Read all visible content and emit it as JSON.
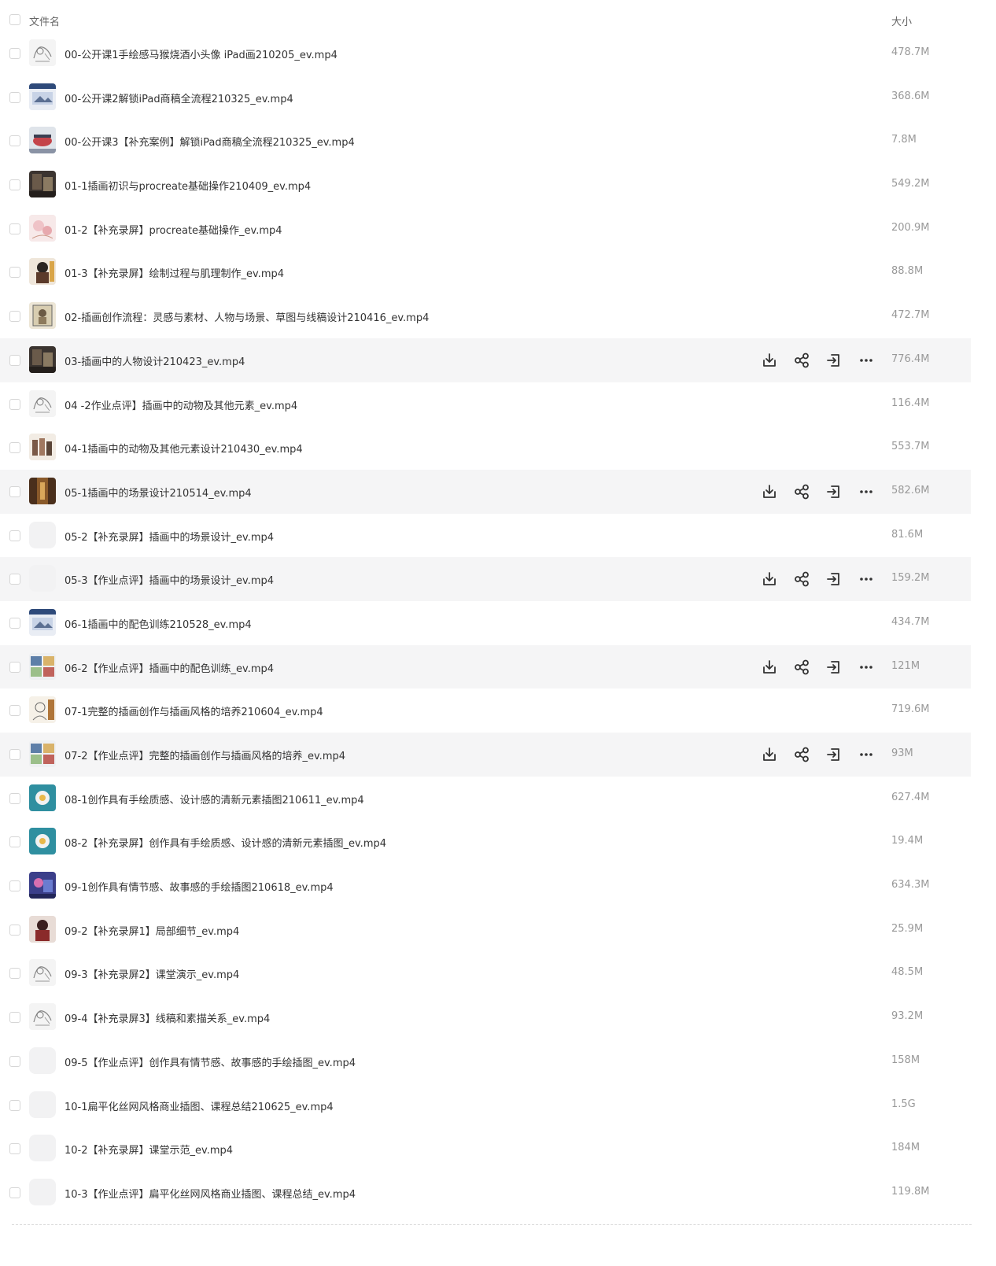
{
  "header": {
    "name_label": "文件名",
    "size_label": "大小"
  },
  "files": [
    {
      "name": "00-公开课1手绘感马猴烧酒小头像 iPad画210205_ev.mp4",
      "size": "478.7M",
      "thumb": "sketch",
      "hover": false
    },
    {
      "name": "00-公开课2解锁iPad商稿全流程210325_ev.mp4",
      "size": "368.6M",
      "thumb": "screen-blue",
      "hover": false
    },
    {
      "name": "00-公开课3【补充案例】解锁iPad商稿全流程210325_ev.mp4",
      "size": "7.8M",
      "thumb": "screen-red",
      "hover": false
    },
    {
      "name": "01-1插画初识与procreate基础操作210409_ev.mp4",
      "size": "549.2M",
      "thumb": "dark-photo",
      "hover": false
    },
    {
      "name": "01-2【补充录屏】procreate基础操作_ev.mp4",
      "size": "200.9M",
      "thumb": "pink",
      "hover": false
    },
    {
      "name": "01-3【补充录屏】绘制过程与肌理制作_ev.mp4",
      "size": "88.8M",
      "thumb": "character",
      "hover": false
    },
    {
      "name": "02-插画创作流程：灵感与素材、人物与场景、草图与线稿设计210416_ev.mp4",
      "size": "472.7M",
      "thumb": "portrait",
      "hover": false
    },
    {
      "name": "03-插画中的人物设计210423_ev.mp4",
      "size": "776.4M",
      "thumb": "dark-photo",
      "hover": true
    },
    {
      "name": "04 -2作业点评】插画中的动物及其他元素_ev.mp4",
      "size": "116.4M",
      "thumb": "sketch",
      "hover": false
    },
    {
      "name": "04-1插画中的动物及其他元素设计210430_ev.mp4",
      "size": "553.7M",
      "thumb": "figures",
      "hover": false
    },
    {
      "name": "05-1插画中的场景设计210514_ev.mp4",
      "size": "582.6M",
      "thumb": "brown",
      "hover": true
    },
    {
      "name": "05-2【补充录屏】插画中的场景设计_ev.mp4",
      "size": "81.6M",
      "thumb": "blank",
      "hover": false
    },
    {
      "name": "05-3【作业点评】插画中的场景设计_ev.mp4",
      "size": "159.2M",
      "thumb": "blank",
      "hover": true
    },
    {
      "name": "06-1插画中的配色训练210528_ev.mp4",
      "size": "434.7M",
      "thumb": "screen-blue",
      "hover": false
    },
    {
      "name": "06-2【作业点评】插画中的配色训练_ev.mp4",
      "size": "121M",
      "thumb": "collage",
      "hover": true
    },
    {
      "name": "07-1完整的插画创作与插画风格的培养210604_ev.mp4",
      "size": "719.6M",
      "thumb": "sketch-color",
      "hover": false
    },
    {
      "name": "07-2【作业点评】完整的插画创作与插画风格的培养_ev.mp4",
      "size": "93M",
      "thumb": "collage",
      "hover": true
    },
    {
      "name": "08-1创作具有手绘质感、设计感的清新元素插图210611_ev.mp4",
      "size": "627.4M",
      "thumb": "teal",
      "hover": false
    },
    {
      "name": "08-2【补充录屏】创作具有手绘质感、设计感的清新元素插图_ev.mp4",
      "size": "19.4M",
      "thumb": "teal",
      "hover": false
    },
    {
      "name": "09-1创作具有情节感、故事感的手绘插图210618_ev.mp4",
      "size": "634.3M",
      "thumb": "purple",
      "hover": false
    },
    {
      "name": "09-2【补充录屏1】局部细节_ev.mp4",
      "size": "25.9M",
      "thumb": "red-dark",
      "hover": false
    },
    {
      "name": "09-3【补充录屏2】课堂演示_ev.mp4",
      "size": "48.5M",
      "thumb": "sketch",
      "hover": false
    },
    {
      "name": "09-4【补充录屏3】线稿和素描关系_ev.mp4",
      "size": "93.2M",
      "thumb": "sketch",
      "hover": false
    },
    {
      "name": "09-5【作业点评】创作具有情节感、故事感的手绘插图_ev.mp4",
      "size": "158M",
      "thumb": "blank",
      "hover": false
    },
    {
      "name": "10-1扁平化丝网风格商业插图、课程总结210625_ev.mp4",
      "size": "1.5G",
      "thumb": "blank",
      "hover": false
    },
    {
      "name": "10-2【补充录屏】课堂示范_ev.mp4",
      "size": "184M",
      "thumb": "blank",
      "hover": false
    },
    {
      "name": "10-3【作业点评】扁平化丝网风格商业插图、课程总结_ev.mp4",
      "size": "119.8M",
      "thumb": "blank",
      "hover": false
    }
  ],
  "actions": [
    "download-icon",
    "share-icon",
    "move-icon",
    "more-icon"
  ]
}
